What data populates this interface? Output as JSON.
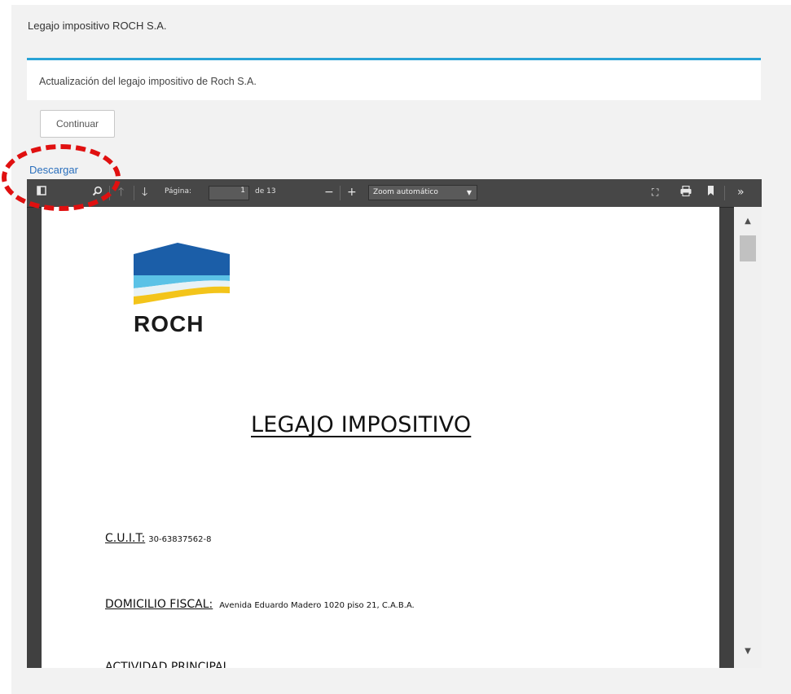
{
  "header": {
    "title": "Legajo impositivo ROCH S.A."
  },
  "description": {
    "text": "Actualización del legajo impositivo de Roch S.A."
  },
  "actions": {
    "continue_label": "Continuar",
    "download_link": "Descargar"
  },
  "colors": {
    "accent": "#29a3d6",
    "link": "#2a6fbd",
    "highlight": "#e01010"
  },
  "pdf_toolbar": {
    "icons": [
      "sidebar-toggle-icon",
      "search-icon",
      "previous-page-icon",
      "next-page-icon",
      "zoom-out-icon",
      "zoom-in-icon",
      "fullscreen-icon",
      "print-icon",
      "bookmark-icon",
      "more-tools-icon"
    ],
    "page_label": "Página:",
    "page_value": "1",
    "page_count_label": "de 13",
    "zoom_value": "Zoom automático"
  },
  "document": {
    "logo_text": "ROCH",
    "title": "LEGAJO IMPOSITIVO",
    "fields": [
      {
        "label": "C.U.I.T:",
        "value": "30-63837562-8"
      },
      {
        "label": "DOMICILIO FISCAL:",
        "value": "Avenida Eduardo Madero 1020 piso 21, C.A.B.A."
      },
      {
        "label": "ACTIVIDAD PRINCIPAL",
        "value": ""
      }
    ]
  }
}
